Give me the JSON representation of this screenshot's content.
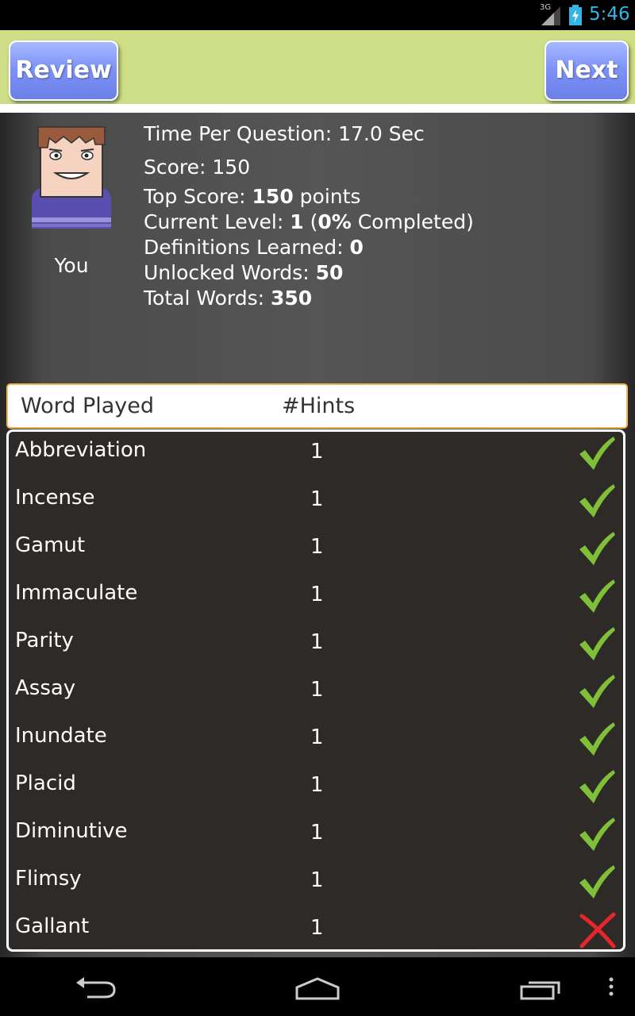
{
  "status": {
    "network": "3G",
    "time": "5:46"
  },
  "toolbar": {
    "review_label": "Review",
    "next_label": "Next"
  },
  "player": {
    "name": "You"
  },
  "stats": {
    "time_per_question": {
      "label": "Time Per Question: ",
      "value": "17.0 Sec"
    },
    "score": {
      "label": "Score: ",
      "value": "150"
    },
    "top_score": {
      "label": "Top Score: ",
      "value": "150",
      "suffix": " points"
    },
    "current_level": {
      "label": "Current Level: ",
      "value": "1",
      "mid": " (",
      "percent": "0%",
      "suffix": " Completed)"
    },
    "definitions_learned": {
      "label": "Definitions Learned: ",
      "value": "0"
    },
    "unlocked_words": {
      "label": "Unlocked Words: ",
      "value": "50"
    },
    "total_words": {
      "label": "Total Words: ",
      "value": "350"
    }
  },
  "table": {
    "headers": [
      "Word Played",
      "#Hints"
    ],
    "rows": [
      {
        "word": "Abbreviation",
        "hints": "1",
        "result": "correct"
      },
      {
        "word": "Incense",
        "hints": "1",
        "result": "correct"
      },
      {
        "word": "Gamut",
        "hints": "1",
        "result": "correct"
      },
      {
        "word": "Immaculate",
        "hints": "1",
        "result": "correct"
      },
      {
        "word": "Parity",
        "hints": "1",
        "result": "correct"
      },
      {
        "word": "Assay",
        "hints": "1",
        "result": "correct"
      },
      {
        "word": "Inundate",
        "hints": "1",
        "result": "correct"
      },
      {
        "word": "Placid",
        "hints": "1",
        "result": "correct"
      },
      {
        "word": "Diminutive",
        "hints": "1",
        "result": "correct"
      },
      {
        "word": "Flimsy",
        "hints": "1",
        "result": "correct"
      },
      {
        "word": "Gallant",
        "hints": "1",
        "result": "wrong"
      }
    ]
  },
  "colors": {
    "correct": "#7fc038",
    "wrong": "#e8252c",
    "accent": "#33b5e5"
  },
  "icons": {
    "correct": "checkmark-icon",
    "wrong": "cross-icon",
    "back": "back-icon",
    "home": "home-icon",
    "recents": "recent-apps-icon",
    "menu": "overflow-menu-icon"
  }
}
